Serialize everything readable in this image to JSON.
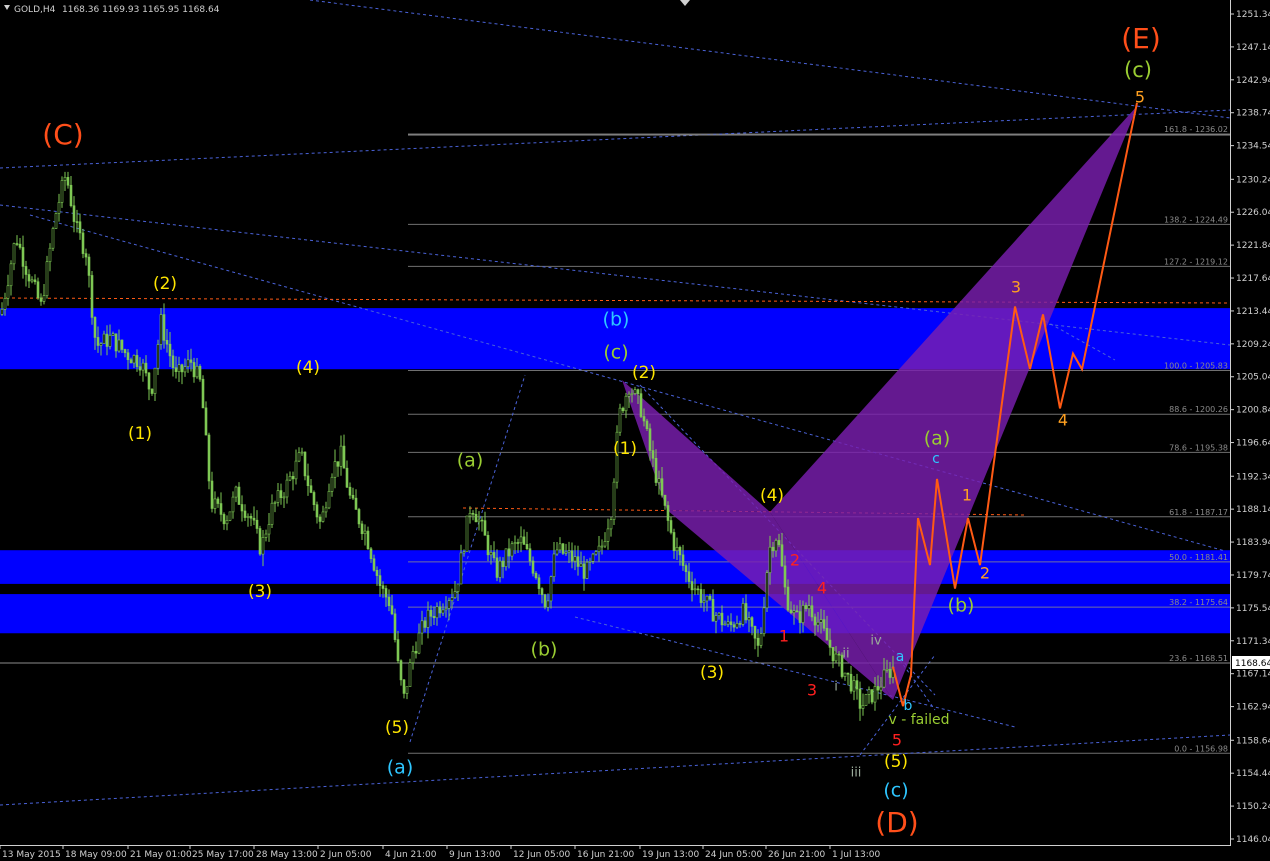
{
  "header": {
    "symbol": "GOLD,H4",
    "ohlc": "1168.36 1169.93 1165.95 1168.64"
  },
  "price_axis": {
    "ticks": [
      "1251.34",
      "1247.14",
      "1242.94",
      "1238.74",
      "1234.54",
      "1230.24",
      "1226.04",
      "1221.84",
      "1217.64",
      "1213.44",
      "1209.24",
      "1205.04",
      "1200.84",
      "1196.64",
      "1192.34",
      "1188.14",
      "1183.94",
      "1179.74",
      "1175.54",
      "1171.34",
      "1167.14",
      "1162.94",
      "1158.64",
      "1154.44",
      "1150.24",
      "1146.04"
    ],
    "current": "1168.64"
  },
  "time_axis": {
    "ticks": [
      "13 May 2015",
      "18 May 09:00",
      "21 May 01:00",
      "25 May 17:00",
      "28 May 13:00",
      "2 Jun 05:00",
      "4 Jun 21:00",
      "9 Jun 13:00",
      "12 Jun 05:00",
      "16 Jun 21:00",
      "19 Jun 13:00",
      "24 Jun 05:00",
      "26 Jun 21:00",
      "1 Jul 13:00"
    ]
  },
  "fib_levels": [
    {
      "label": "161.8 - 1236.02",
      "price": 1236.02
    },
    {
      "label": "138.2 - 1224.49",
      "price": 1224.49
    },
    {
      "label": "127.2 - 1219.12",
      "price": 1219.12
    },
    {
      "label": "100.0 - 1205.83",
      "price": 1205.83
    },
    {
      "label": "88.6 - 1200.26",
      "price": 1200.26
    },
    {
      "label": "78.6 - 1195.38",
      "price": 1195.38
    },
    {
      "label": "61.8 - 1187.17",
      "price": 1187.17
    },
    {
      "label": "50.0 - 1181.41",
      "price": 1181.41
    },
    {
      "label": "38.2 - 1175.64",
      "price": 1175.64
    },
    {
      "label": "23.6 - 1168.51",
      "price": 1168.51
    },
    {
      "label": "0.0 - 1156.98",
      "price": 1156.98
    }
  ],
  "zones": [
    {
      "from": 1206.0,
      "to": 1213.8
    },
    {
      "from": 1178.6,
      "to": 1182.9
    },
    {
      "from": 1172.3,
      "to": 1177.3
    }
  ],
  "colors": {
    "zone": "#0000ff",
    "candle": "#7ec854",
    "pattern": "#7a1fb0",
    "projection": "#ff5a14",
    "fib": "#8c8c8c",
    "trend": "#4a62d8",
    "red_dash": "#ff5a14"
  },
  "wave_labels": [
    {
      "text": "(C)",
      "color": "#ff4f1a"
    },
    {
      "text": "(2)",
      "color": "#ffe600"
    },
    {
      "text": "(1)",
      "color": "#ffe600"
    },
    {
      "text": "(4)",
      "color": "#ffe600"
    },
    {
      "text": "(3)",
      "color": "#ffe600"
    },
    {
      "text": "(5)",
      "color": "#ffe600"
    },
    {
      "text": "(a)",
      "color": "#2ec6ff"
    },
    {
      "text": "(a)",
      "color": "#9acd32"
    },
    {
      "text": "(b)",
      "color": "#9acd32"
    },
    {
      "text": "(b)",
      "color": "#2ec6ff"
    },
    {
      "text": "(c)",
      "color": "#9acd32"
    },
    {
      "text": "(2)",
      "color": "#ffe600"
    },
    {
      "text": "(1)",
      "color": "#ffe600"
    },
    {
      "text": "(3)",
      "color": "#ffe600"
    },
    {
      "text": "(4)",
      "color": "#ffe600"
    },
    {
      "text": "2",
      "color": "#ff2020"
    },
    {
      "text": "4",
      "color": "#ff2020"
    },
    {
      "text": "1",
      "color": "#ff2020"
    },
    {
      "text": "3",
      "color": "#ff2020"
    },
    {
      "text": "5",
      "color": "#ff2020"
    },
    {
      "text": "iv",
      "color": "#9aaa9a"
    },
    {
      "text": "ii",
      "color": "#9aaa9a"
    },
    {
      "text": "i",
      "color": "#9aaa9a"
    },
    {
      "text": "iii",
      "color": "#9aaa9a"
    },
    {
      "text": "a",
      "color": "#2ec6ff"
    },
    {
      "text": "b",
      "color": "#2ec6ff"
    },
    {
      "text": "v - failed",
      "color": "#9acd32"
    },
    {
      "text": "(5)",
      "color": "#ffe600"
    },
    {
      "text": "(c)",
      "color": "#2ec6ff"
    },
    {
      "text": "(D)",
      "color": "#ff4f1a"
    },
    {
      "text": "(a)",
      "color": "#9acd32"
    },
    {
      "text": "c",
      "color": "#2ec6ff"
    },
    {
      "text": "1",
      "color": "#ffa020"
    },
    {
      "text": "2",
      "color": "#ffa020"
    },
    {
      "text": "(b)",
      "color": "#9acd32"
    },
    {
      "text": "3",
      "color": "#ffa020"
    },
    {
      "text": "4",
      "color": "#ffa020"
    },
    {
      "text": "5",
      "color": "#ffa020"
    },
    {
      "text": "(c)",
      "color": "#9acd32"
    },
    {
      "text": "(E)",
      "color": "#ff4f1a"
    }
  ],
  "chart_data": {
    "type": "candlestick",
    "symbol": "GOLD",
    "timeframe": "H4",
    "ylim": [
      1146.04,
      1251.34
    ],
    "last_price": 1168.64,
    "close_path": [
      [
        0,
        1213
      ],
      [
        15,
        1223
      ],
      [
        25,
        1219
      ],
      [
        40,
        1214
      ],
      [
        55,
        1226
      ],
      [
        65,
        1231
      ],
      [
        75,
        1224
      ],
      [
        85,
        1221
      ],
      [
        95,
        1209
      ],
      [
        110,
        1210
      ],
      [
        125,
        1208
      ],
      [
        140,
        1207
      ],
      [
        150,
        1203
      ],
      [
        160,
        1212
      ],
      [
        175,
        1205
      ],
      [
        190,
        1207
      ],
      [
        200,
        1204
      ],
      [
        210,
        1189
      ],
      [
        225,
        1187
      ],
      [
        235,
        1190
      ],
      [
        250,
        1187
      ],
      [
        260,
        1183
      ],
      [
        270,
        1188
      ],
      [
        285,
        1191
      ],
      [
        300,
        1195
      ],
      [
        310,
        1190
      ],
      [
        320,
        1186
      ],
      [
        330,
        1193
      ],
      [
        340,
        1195
      ],
      [
        350,
        1189
      ],
      [
        365,
        1185
      ],
      [
        380,
        1178
      ],
      [
        390,
        1176
      ],
      [
        398,
        1167
      ],
      [
        403,
        1164
      ],
      [
        412,
        1170
      ],
      [
        425,
        1174
      ],
      [
        440,
        1176
      ],
      [
        455,
        1178
      ],
      [
        470,
        1189
      ],
      [
        480,
        1186
      ],
      [
        495,
        1180
      ],
      [
        510,
        1183
      ],
      [
        520,
        1184
      ],
      [
        535,
        1180
      ],
      [
        545,
        1176
      ],
      [
        555,
        1183
      ],
      [
        570,
        1182
      ],
      [
        585,
        1180
      ],
      [
        600,
        1183
      ],
      [
        610,
        1188
      ],
      [
        618,
        1200
      ],
      [
        628,
        1204
      ],
      [
        640,
        1201
      ],
      [
        650,
        1195
      ],
      [
        660,
        1190
      ],
      [
        672,
        1184
      ],
      [
        685,
        1180
      ],
      [
        700,
        1177
      ],
      [
        712,
        1175
      ],
      [
        728,
        1173
      ],
      [
        742,
        1175
      ],
      [
        758,
        1170
      ],
      [
        768,
        1183
      ],
      [
        776,
        1185
      ],
      [
        785,
        1177
      ],
      [
        795,
        1174
      ],
      [
        808,
        1176
      ],
      [
        820,
        1173
      ],
      [
        835,
        1169
      ],
      [
        850,
        1166
      ],
      [
        860,
        1163
      ],
      [
        875,
        1165
      ],
      [
        885,
        1167
      ],
      [
        893,
        1168
      ]
    ],
    "projection_path": [
      [
        893,
        1168
      ],
      [
        903,
        1163
      ],
      [
        911,
        1167
      ],
      [
        918,
        1187
      ],
      [
        930,
        1181
      ],
      [
        937,
        1192
      ],
      [
        955,
        1178
      ],
      [
        968,
        1187
      ],
      [
        980,
        1181
      ],
      [
        1015,
        1214
      ],
      [
        1030,
        1206
      ],
      [
        1043,
        1213
      ],
      [
        1060,
        1201
      ],
      [
        1073,
        1208
      ],
      [
        1082,
        1206
      ],
      [
        1137,
        1240
      ]
    ]
  }
}
